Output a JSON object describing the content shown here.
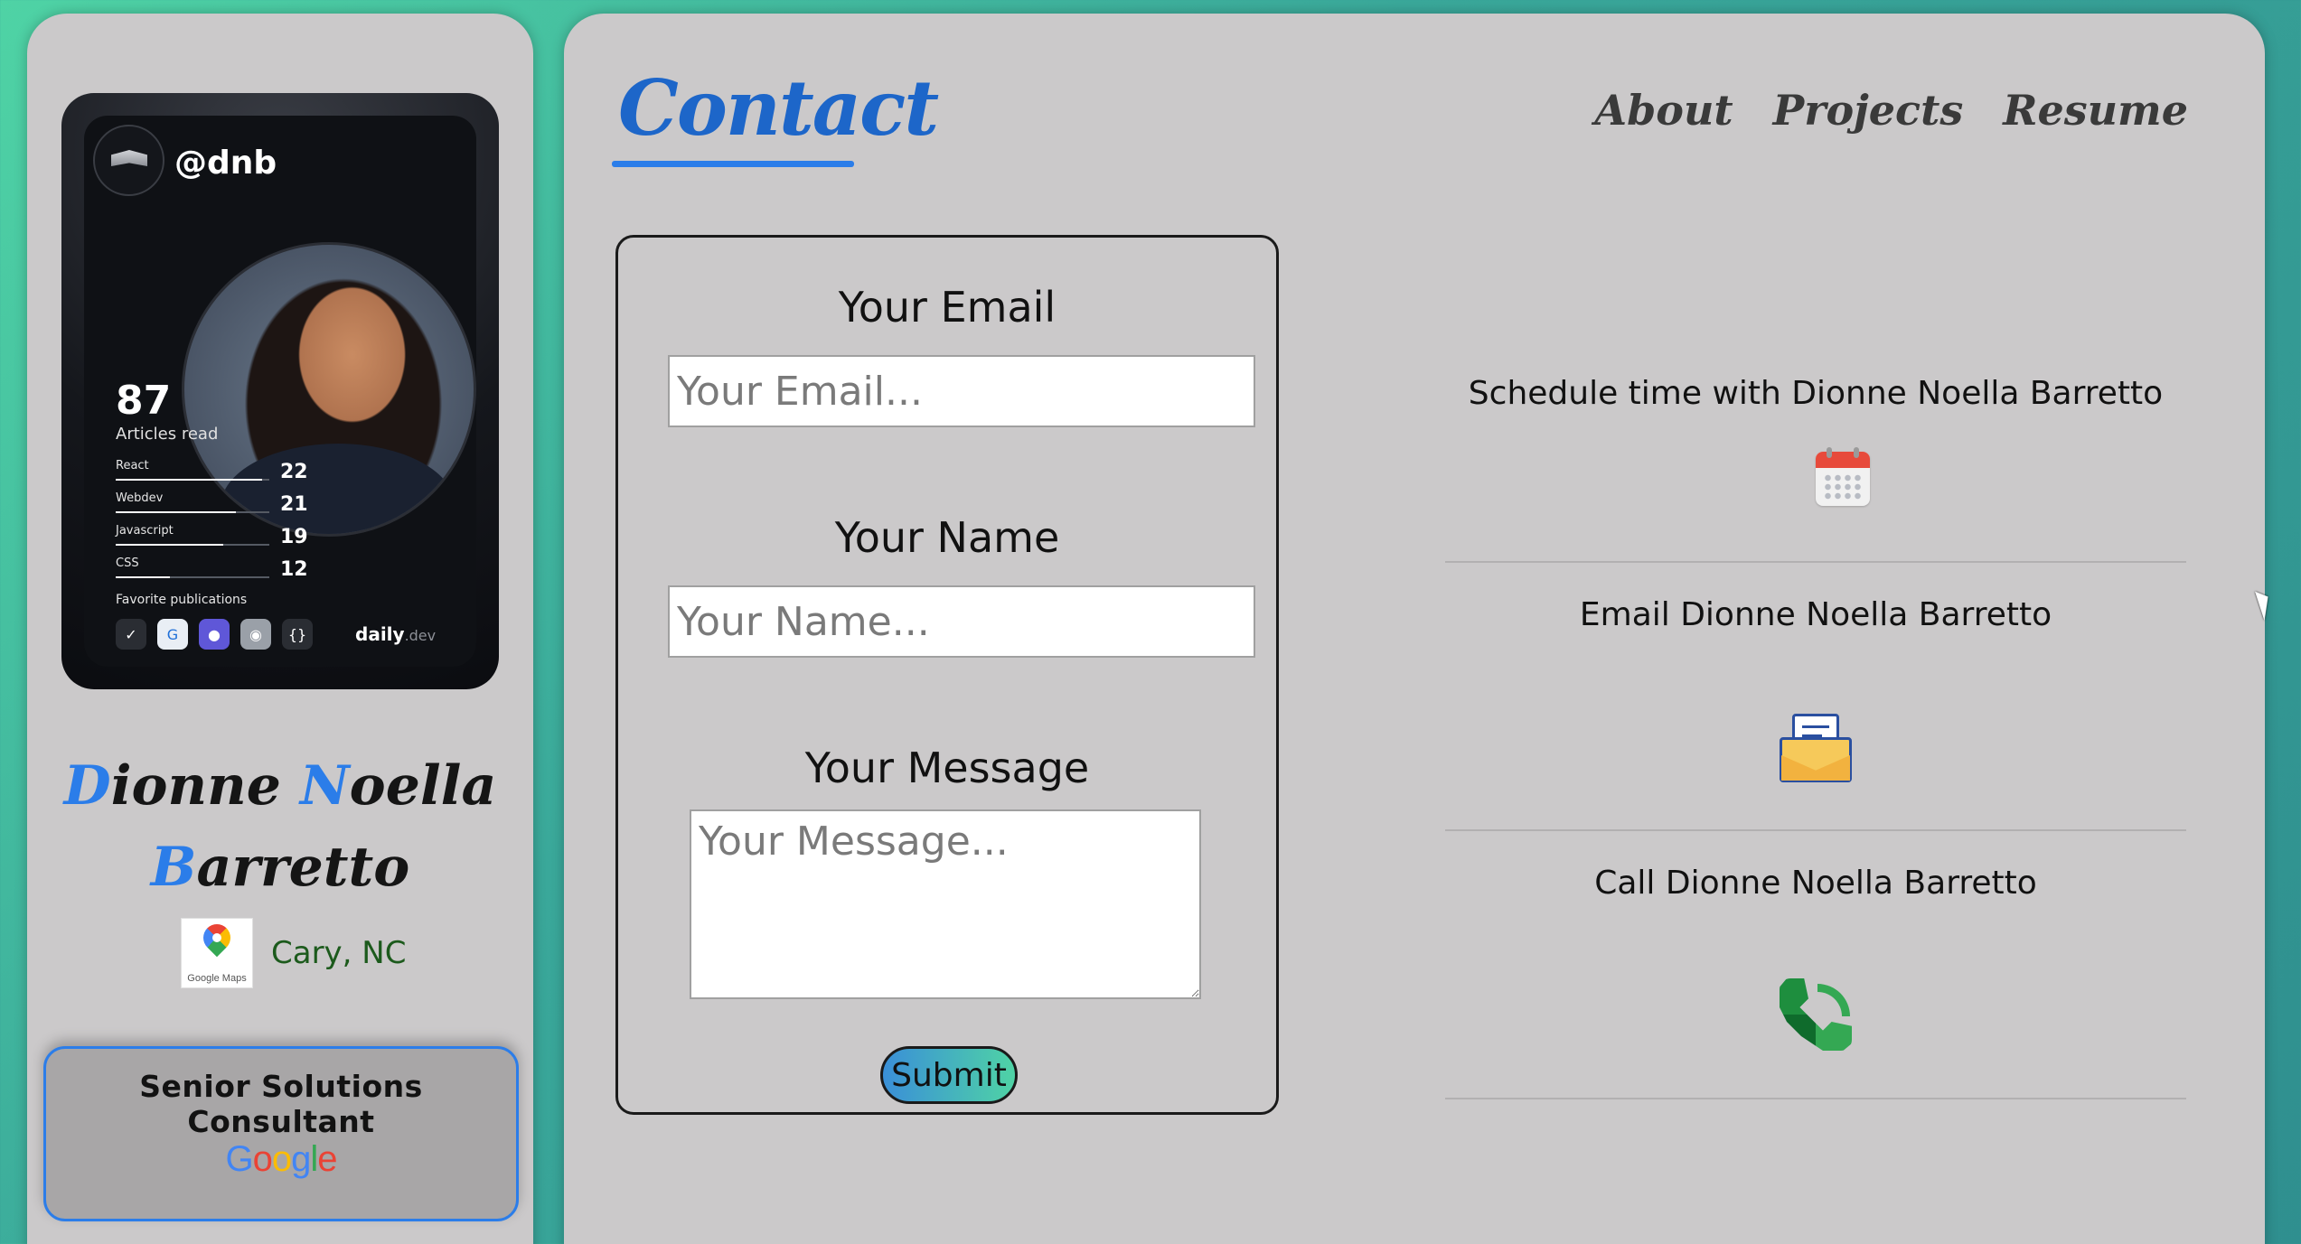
{
  "sidebar": {
    "devcard": {
      "handle": "@dnb",
      "articles_count": "87",
      "articles_label": "Articles read",
      "tags": [
        {
          "name": "React",
          "count": "22",
          "fill": 0.95
        },
        {
          "name": "Webdev",
          "count": "21",
          "fill": 0.78
        },
        {
          "name": "Javascript",
          "count": "19",
          "fill": 0.7
        },
        {
          "name": "CSS",
          "count": "12",
          "fill": 0.35
        }
      ],
      "favorites_label": "Favorite publications",
      "publication_icons": [
        "daily-dev-icon",
        "google-translate-icon",
        "profile-photo-icon",
        "camera-icon",
        "code-braces-icon"
      ],
      "brand_main": "daily",
      "brand_sub": ".dev"
    },
    "name": {
      "first_initial": "D",
      "first_rest": "ionne ",
      "middle_initial": "N",
      "middle_rest": "oella",
      "last_initial": "B",
      "last_rest": "arretto"
    },
    "location": {
      "maps_label": "Google Maps",
      "city": "Cary, NC"
    },
    "job": {
      "title": "Senior Solutions Consultant",
      "company_logo": "Google"
    }
  },
  "header": {
    "title": "Contact",
    "nav": [
      {
        "label": "About"
      },
      {
        "label": "Projects"
      },
      {
        "label": "Resume"
      }
    ]
  },
  "form": {
    "email_label": "Your Email",
    "email_placeholder": "Your Email...",
    "name_label": "Your Name",
    "name_placeholder": "Your Name...",
    "message_label": "Your Message",
    "message_placeholder": "Your Message...",
    "submit_label": "Submit"
  },
  "contact_options": {
    "schedule": {
      "label": "Schedule time with Dionne Noella Barretto",
      "icon": "calendar-icon"
    },
    "email": {
      "label": "Email Dionne Noella Barretto",
      "icon": "envelope-icon"
    },
    "call": {
      "label": "Call Dionne Noella Barretto",
      "icon": "phone-icon"
    }
  },
  "colors": {
    "accent": "#2b7de9",
    "panel": "#cbc9ca",
    "background_start": "#4fd3a5",
    "background_end": "#2f8f8f"
  }
}
